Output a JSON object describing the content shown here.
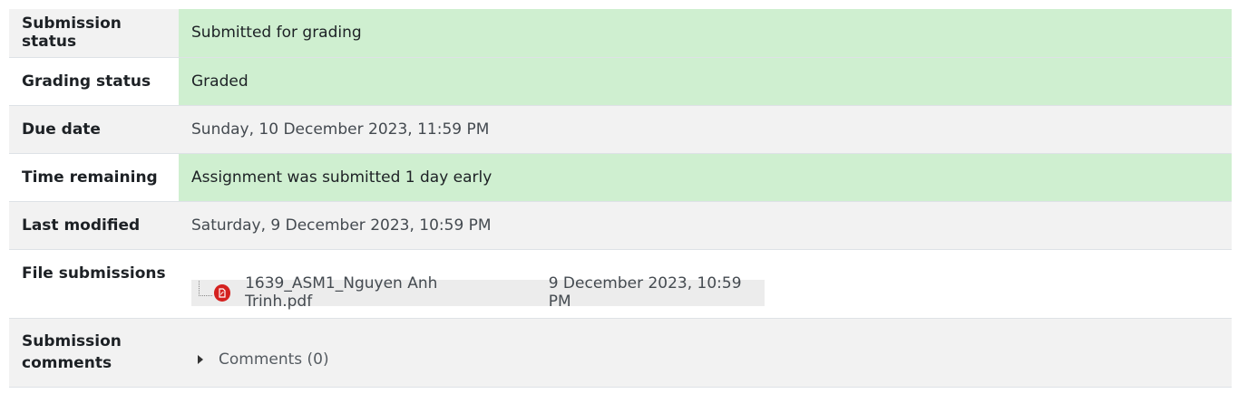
{
  "rows": {
    "submission_status": {
      "label": "Submission status",
      "value": "Submitted for grading"
    },
    "grading_status": {
      "label": "Grading status",
      "value": "Graded"
    },
    "due_date": {
      "label": "Due date",
      "value": "Sunday, 10 December 2023, 11:59 PM"
    },
    "time_remaining": {
      "label": "Time remaining",
      "value": "Assignment was submitted 1 day early"
    },
    "last_modified": {
      "label": "Last modified",
      "value": "Saturday, 9 December 2023, 10:59 PM"
    },
    "file_submissions": {
      "label": "File submissions",
      "file": {
        "name": "1639_ASM1_Nguyen Anh Trinh.pdf",
        "date": "9 December 2023, 10:59 PM",
        "icon": "pdf-icon"
      }
    },
    "submission_comments": {
      "label_line1": "Submission",
      "label_line2": "comments",
      "toggle_label": "Comments (0)",
      "icon": "caret-right-icon"
    }
  },
  "colors": {
    "success_bg": "#cfefd0",
    "row_grey": "#f2f2f2",
    "pdf_red": "#d4211f"
  }
}
